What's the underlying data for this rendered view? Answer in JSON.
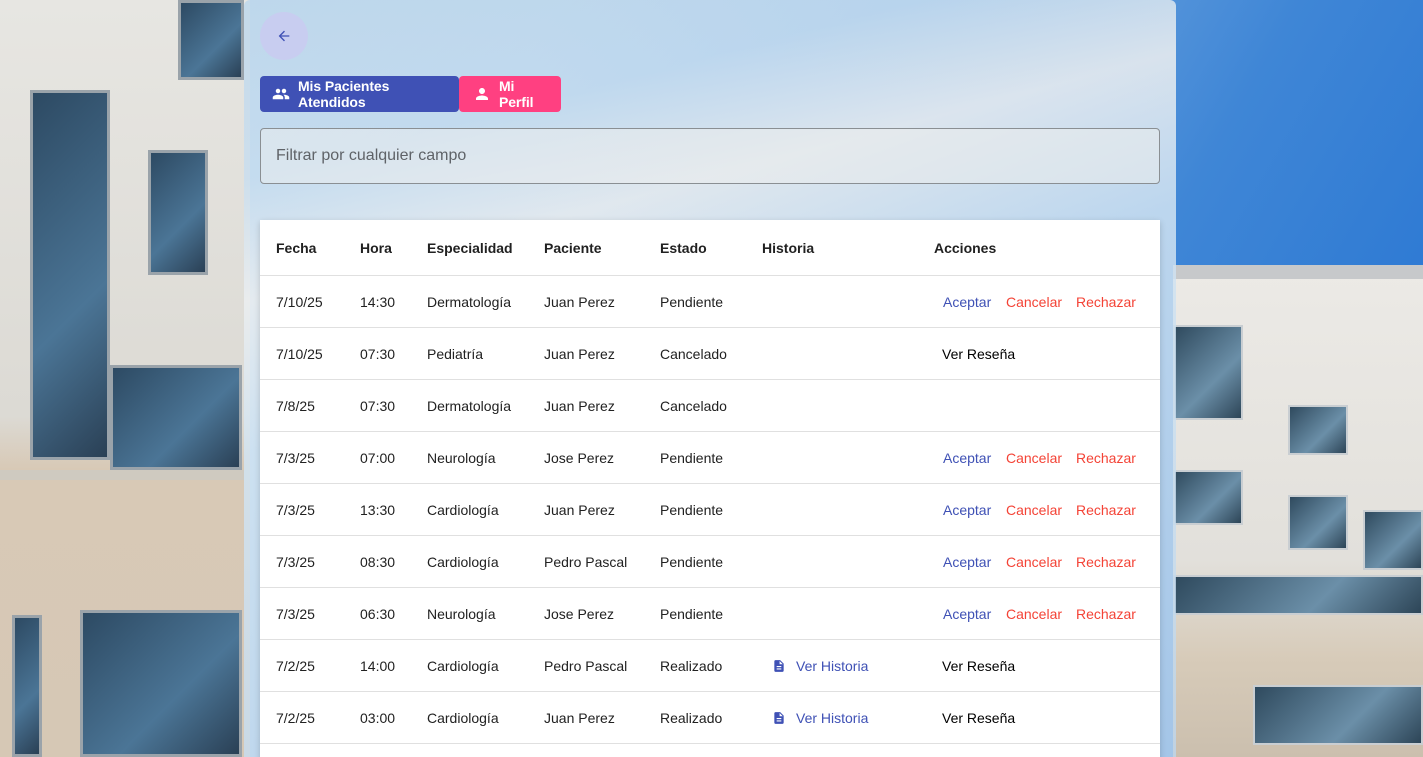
{
  "nav": {
    "back_icon": "arrow-back-icon",
    "patients_button": {
      "label": "Mis Pacientes Atendidos",
      "icon": "people-icon",
      "color": "#3f51b5"
    },
    "profile_button": {
      "label": "Mi Perfil",
      "icon": "person-icon",
      "color": "#ff4081"
    }
  },
  "filter": {
    "placeholder": "Filtrar por cualquier campo",
    "value": ""
  },
  "table": {
    "headers": {
      "fecha": "Fecha",
      "hora": "Hora",
      "especialidad": "Especialidad",
      "paciente": "Paciente",
      "estado": "Estado",
      "historia": "Historia",
      "acciones": "Acciones"
    },
    "actions": {
      "aceptar": "Aceptar",
      "cancelar": "Cancelar",
      "rechazar": "Rechazar",
      "ver_resena": "Ver Reseña",
      "ver_historia": "Ver Historia"
    },
    "rows": [
      {
        "fecha": "7/10/25",
        "hora": "14:30",
        "especialidad": "Dermatología",
        "paciente": "Juan Perez",
        "estado": "Pendiente",
        "historia": "",
        "acciones": [
          "Aceptar",
          "Cancelar",
          "Rechazar"
        ]
      },
      {
        "fecha": "7/10/25",
        "hora": "07:30",
        "especialidad": "Pediatría",
        "paciente": "Juan Perez",
        "estado": "Cancelado",
        "historia": "",
        "acciones": [
          "Ver Reseña"
        ]
      },
      {
        "fecha": "7/8/25",
        "hora": "07:30",
        "especialidad": "Dermatología",
        "paciente": "Juan Perez",
        "estado": "Cancelado",
        "historia": "",
        "acciones": []
      },
      {
        "fecha": "7/3/25",
        "hora": "07:00",
        "especialidad": "Neurología",
        "paciente": "Jose Perez",
        "estado": "Pendiente",
        "historia": "",
        "acciones": [
          "Aceptar",
          "Cancelar",
          "Rechazar"
        ]
      },
      {
        "fecha": "7/3/25",
        "hora": "13:30",
        "especialidad": "Cardiología",
        "paciente": "Juan Perez",
        "estado": "Pendiente",
        "historia": "",
        "acciones": [
          "Aceptar",
          "Cancelar",
          "Rechazar"
        ]
      },
      {
        "fecha": "7/3/25",
        "hora": "08:30",
        "especialidad": "Cardiología",
        "paciente": "Pedro Pascal",
        "estado": "Pendiente",
        "historia": "",
        "acciones": [
          "Aceptar",
          "Cancelar",
          "Rechazar"
        ]
      },
      {
        "fecha": "7/3/25",
        "hora": "06:30",
        "especialidad": "Neurología",
        "paciente": "Jose Perez",
        "estado": "Pendiente",
        "historia": "",
        "acciones": [
          "Aceptar",
          "Cancelar",
          "Rechazar"
        ]
      },
      {
        "fecha": "7/2/25",
        "hora": "14:00",
        "especialidad": "Cardiología",
        "paciente": "Pedro Pascal",
        "estado": "Realizado",
        "historia": "Ver Historia",
        "acciones": [
          "Ver Reseña"
        ]
      },
      {
        "fecha": "7/2/25",
        "hora": "03:00",
        "especialidad": "Cardiología",
        "paciente": "Juan Perez",
        "estado": "Realizado",
        "historia": "Ver Historia",
        "acciones": [
          "Ver Reseña"
        ]
      }
    ]
  },
  "colors": {
    "primary": "#3f51b5",
    "accent": "#ff4081",
    "warn": "#f44336"
  }
}
